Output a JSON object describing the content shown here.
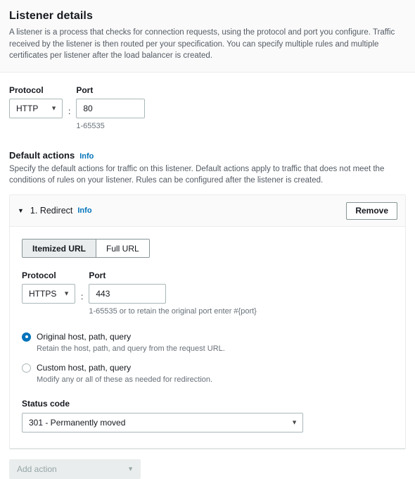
{
  "header": {
    "title": "Listener details",
    "description": "A listener is a process that checks for connection requests, using the protocol and port you configure. Traffic received by the listener is then routed per your specification. You can specify multiple rules and multiple certificates per listener after the load balancer is created."
  },
  "listener": {
    "protocol_label": "Protocol",
    "protocol_value": "HTTP",
    "separator": ":",
    "port_label": "Port",
    "port_value": "80",
    "port_hint": "1-65535"
  },
  "default_actions": {
    "title": "Default actions",
    "info_label": "Info",
    "description": "Specify the default actions for traffic on this listener. Default actions apply to traffic that does not meet the conditions of rules on your listener. Rules can be configured after the listener is created."
  },
  "action_panel": {
    "toggle_icon": "▼",
    "title": "1. Redirect",
    "info_label": "Info",
    "remove_label": "Remove",
    "tabs": [
      {
        "label": "Itemized URL",
        "selected": true
      },
      {
        "label": "Full URL",
        "selected": false
      }
    ],
    "protocol_label": "Protocol",
    "protocol_value": "HTTPS",
    "separator": ":",
    "port_label": "Port",
    "port_value": "443",
    "port_hint": "1-65535 or to retain the original port enter #{port}",
    "radios": [
      {
        "label": "Original host, path, query",
        "description": "Retain the host, path, and query from the request URL.",
        "selected": true
      },
      {
        "label": "Custom host, path, query",
        "description": "Modify any or all of these as needed for redirection.",
        "selected": false
      }
    ],
    "status_code_label": "Status code",
    "status_code_value": "301 - Permanently moved"
  },
  "add_action": {
    "label": "Add action",
    "caret": "▼"
  },
  "icons": {
    "caret_down": "▼"
  },
  "colors": {
    "accent_link": "#0073bb",
    "radio_selected": "#0073bb",
    "panel_bg": "#fafafa",
    "border": "#aab7b8",
    "disabled_bg": "#eaeded"
  }
}
